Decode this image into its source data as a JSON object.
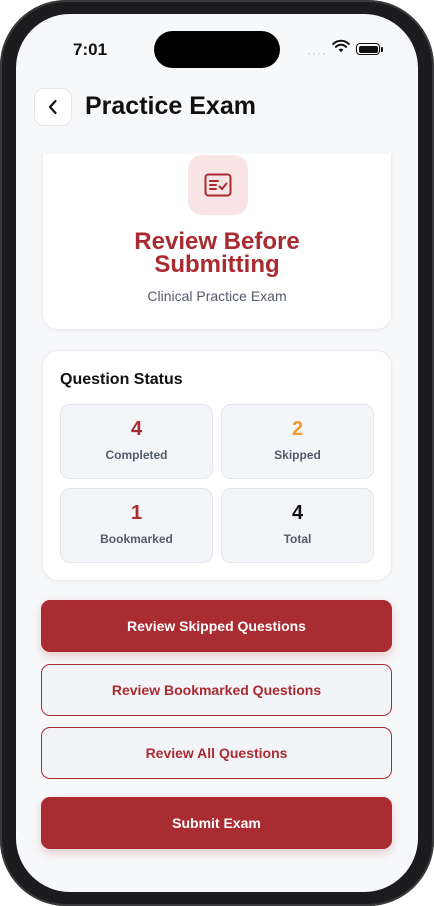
{
  "status_bar": {
    "time": "7:01",
    "signal": "····"
  },
  "header": {
    "title": "Practice Exam",
    "back_icon": "chevron-left-icon"
  },
  "review": {
    "icon": "checklist-icon",
    "title_line1": "Review Before",
    "title_line2": "Submitting",
    "subtitle": "Clinical Practice Exam"
  },
  "question_status": {
    "title": "Question Status",
    "stats": [
      {
        "value": "4",
        "label": "Completed",
        "color": "#a92b31"
      },
      {
        "value": "2",
        "label": "Skipped",
        "color": "#f39a2b"
      },
      {
        "value": "1",
        "label": "Bookmarked",
        "color": "#a92b31"
      },
      {
        "value": "4",
        "label": "Total",
        "color": "#111111"
      }
    ]
  },
  "actions": {
    "review_skipped": "Review Skipped Questions",
    "review_bookmarked": "Review Bookmarked Questions",
    "review_all": "Review All Questions",
    "submit": "Submit Exam"
  },
  "colors": {
    "brand": "#aa2c33",
    "warning": "#f39a2b",
    "icon_bg": "#f8e4e5"
  }
}
